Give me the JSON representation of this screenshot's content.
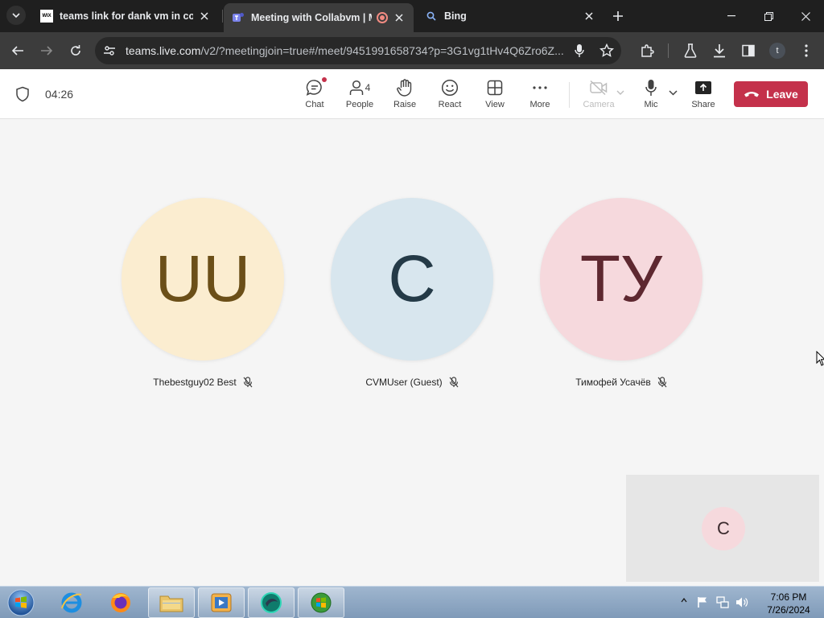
{
  "browser": {
    "tabs": [
      {
        "favicon": "wix-icon",
        "title": "teams link for dank vm in comm",
        "active": false
      },
      {
        "favicon": "teams-icon",
        "title": "Meeting with Collabvm | M",
        "active": true,
        "recording": true
      },
      {
        "favicon": "search-icon",
        "title": "Bing",
        "active": false
      }
    ],
    "url_host": "teams.live.com",
    "url_path": "/v2/?meetingjoin=true#/meet/9451991658734?p=3G1vg1tHv4Q6Zro6Z...",
    "profile_initial": "t"
  },
  "teams": {
    "timer": "04:26",
    "controls": {
      "chat": "Chat",
      "people": "People",
      "people_count": "4",
      "raise": "Raise",
      "react": "React",
      "view": "View",
      "more": "More",
      "camera": "Camera",
      "mic": "Mic",
      "share": "Share",
      "leave": "Leave"
    },
    "participants": [
      {
        "initials": "UU",
        "name": "Thebestguy02 Best",
        "bg": "#fbedd0",
        "fg": "#6b4f18",
        "muted": true
      },
      {
        "initials": "C",
        "name": "CVMUser (Guest)",
        "bg": "#d8e6ee",
        "fg": "#243a47",
        "muted": true
      },
      {
        "initials": "ТУ",
        "name": "Тимофей Усачёв",
        "bg": "#f6d9dd",
        "fg": "#5e2830",
        "muted": true
      }
    ],
    "self_view": {
      "initials": "C"
    }
  },
  "taskbar": {
    "time": "7:06 PM",
    "date": "7/26/2024",
    "apps": [
      "internet-explorer-icon",
      "firefox-icon",
      "file-explorer-icon",
      "media-player-icon",
      "collabvm-icon",
      "windows-update-icon"
    ]
  },
  "colors": {
    "leave_button": "#c4314b",
    "stage_bg": "#f5f5f5",
    "browser_chrome": "#1f1f1f"
  }
}
